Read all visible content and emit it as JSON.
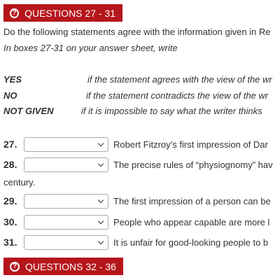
{
  "section1": {
    "title": "QUESTIONS 27 - 31",
    "icon": "question-circle-icon",
    "color": "#b5161b"
  },
  "instructions": {
    "line1": "Do the following statements agree with the information given in Re",
    "line2": "In boxes 27-31 on your answer sheet, write"
  },
  "legend": [
    {
      "key": "YES",
      "desc": "if the statement agrees with the view of the wr"
    },
    {
      "key": "NO",
      "desc": "if the statement contradicts the view of the wr"
    },
    {
      "key": "NOT GIVEN",
      "desc": "if it is impossible to say what the writer thinks"
    }
  ],
  "questions": [
    {
      "num": "27.",
      "selected": "",
      "text": "Robert Fitzroy’s first impression of Dar"
    },
    {
      "num": "28.",
      "selected": "",
      "text": "The precise rules of “physiognomy” hav",
      "continuation": "century."
    },
    {
      "num": "29.",
      "selected": "",
      "text": "The first impression of a person can be"
    },
    {
      "num": "30.",
      "selected": "",
      "text": "People who appear capable are more l"
    },
    {
      "num": "31.",
      "selected": "",
      "text": "It is unfair for good-looking people to b"
    }
  ],
  "section2": {
    "title": "QUESTIONS 32 - 36",
    "icon": "question-circle-icon"
  }
}
